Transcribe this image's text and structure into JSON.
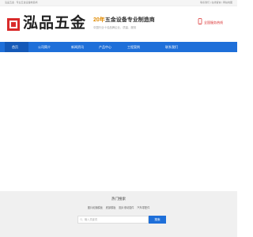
{
  "topbar": {
    "left_text": "泓品五金 · 专业五金设备制造商",
    "right_text": "联系我们 | 在线留言 | 网站地图"
  },
  "header": {
    "logo_text": "泓品五金",
    "slogan_year": "20年",
    "slogan_text": "五金设备专业制造商",
    "slogan_sub": "中国行业十佳品牌企业、质量、服务",
    "hotline_label": "全国服务热线"
  },
  "nav": {
    "items": [
      {
        "label": "首页"
      },
      {
        "label": "公司简介"
      },
      {
        "label": "新闻资讯"
      },
      {
        "label": "产品中心"
      },
      {
        "label": "工程案例"
      },
      {
        "label": "联系我们"
      }
    ]
  },
  "footer": {
    "hot_title": "热门搜索",
    "tags": [
      "图片轮播模板",
      "底部模板",
      "图片滚动插件",
      "汽车零配件"
    ],
    "search_placeholder": "输入关键词",
    "search_button": "搜索"
  },
  "colors": {
    "brand_red": "#d92b2b",
    "nav_blue": "#1e6fd9",
    "accent_orange": "#e08a00"
  }
}
